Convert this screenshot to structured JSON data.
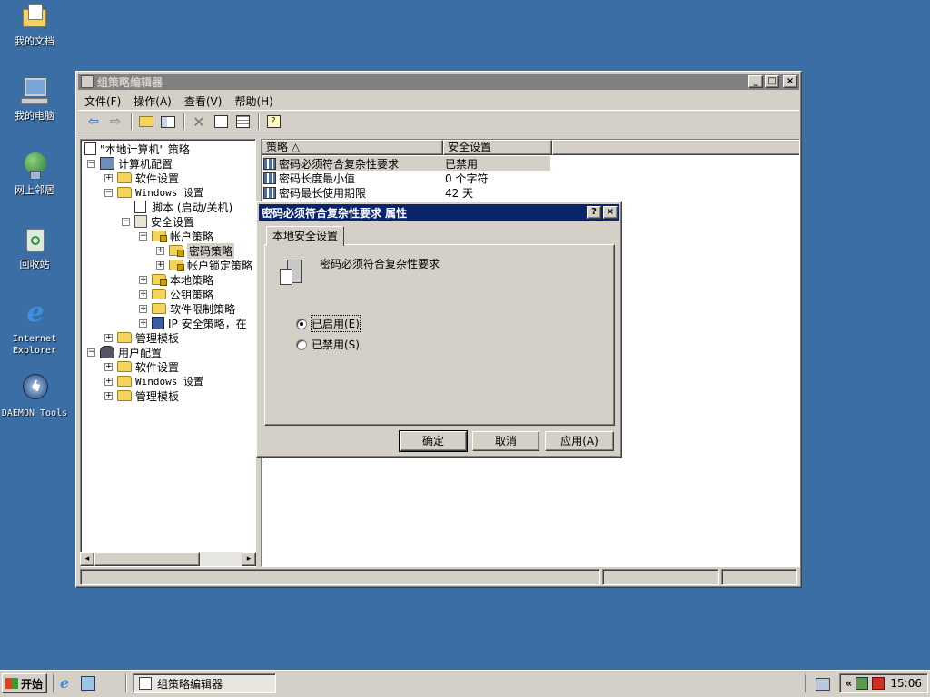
{
  "desktop": {
    "icons": [
      {
        "label": "我的文档"
      },
      {
        "label": "我的电脑"
      },
      {
        "label": "网上邻居"
      },
      {
        "label": "回收站"
      },
      {
        "label": "Internet Explorer"
      },
      {
        "label": "DAEMON Tools"
      }
    ]
  },
  "window": {
    "title": "组策略编辑器",
    "controls": {
      "minimize": "_",
      "maximize": "□",
      "close": "×"
    },
    "menu": [
      "文件(F)",
      "操作(A)",
      "查看(V)",
      "帮助(H)"
    ],
    "toolbar": {
      "back": "⇦",
      "forward": "⇨"
    },
    "tree": {
      "items": [
        {
          "label": "\"本地计算机\" 策略",
          "expander": ""
        },
        {
          "label": "计算机配置",
          "expander": "−"
        },
        {
          "label": "软件设置",
          "expander": "+"
        },
        {
          "label": "Windows 设置",
          "expander": "−"
        },
        {
          "label": "脚本 (启动/关机)",
          "expander": ""
        },
        {
          "label": "安全设置",
          "expander": "−"
        },
        {
          "label": "帐户策略",
          "expander": "−"
        },
        {
          "label": "密码策略",
          "expander": "+"
        },
        {
          "label": "帐户锁定策略",
          "expander": "+"
        },
        {
          "label": "本地策略",
          "expander": "+"
        },
        {
          "label": "公钥策略",
          "expander": "+"
        },
        {
          "label": "软件限制策略",
          "expander": "+"
        },
        {
          "label": "IP 安全策略，在",
          "expander": "+"
        },
        {
          "label": "管理模板",
          "expander": "+"
        },
        {
          "label": "用户配置",
          "expander": "−"
        },
        {
          "label": "软件设置",
          "expander": "+"
        },
        {
          "label": "Windows 设置",
          "expander": "+"
        },
        {
          "label": "管理模板",
          "expander": "+"
        }
      ]
    },
    "list": {
      "columns": [
        "策略 △",
        "安全设置"
      ],
      "rows": [
        {
          "policy": "密码必须符合复杂性要求",
          "setting": "已禁用"
        },
        {
          "policy": "密码长度最小值",
          "setting": "0 个字符"
        },
        {
          "policy": "密码最长使用期限",
          "setting": "42 天"
        }
      ]
    },
    "scroll": {
      "left": "◂",
      "right": "▸"
    }
  },
  "dialog": {
    "title": "密码必须符合复杂性要求 属性",
    "help": "?",
    "close": "×",
    "tab": "本地安全设置",
    "policy_name": "密码必须符合复杂性要求",
    "options": [
      {
        "label": "已启用(E)",
        "checked": true
      },
      {
        "label": "已禁用(S)",
        "checked": false
      }
    ],
    "buttons": {
      "ok": "确定",
      "cancel": "取消",
      "apply": "应用(A)"
    }
  },
  "taskbar": {
    "start": "开始",
    "task": "组策略编辑器",
    "tray_chevron": "«",
    "clock": "15:06"
  }
}
